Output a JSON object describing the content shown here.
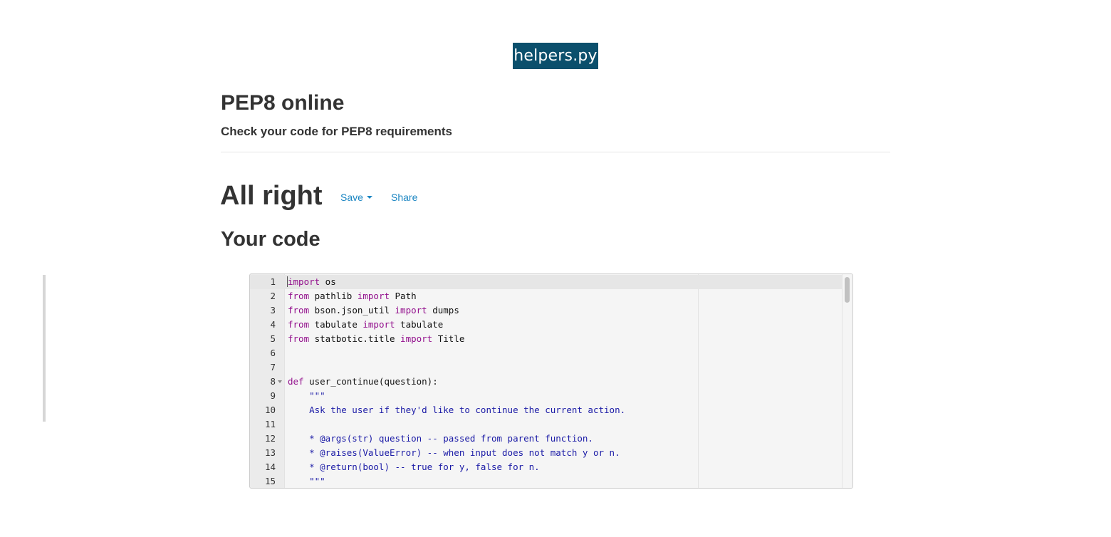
{
  "badge": {
    "filename": "helpers.py"
  },
  "header": {
    "title": "PEP8 online",
    "subtitle": "Check your code for PEP8 requirements"
  },
  "result": {
    "status": "All right",
    "save_label": "Save",
    "share_label": "Share"
  },
  "code_section": {
    "title": "Your code"
  },
  "colors": {
    "badge_bg": "#0b4f6c",
    "link": "#1a85c2",
    "keyword": "#93108d",
    "string": "#1a1aa6"
  },
  "editor": {
    "lines": [
      {
        "n": "1",
        "tokens": [
          {
            "t": "import",
            "c": "kw"
          },
          {
            "t": " os",
            "c": "id"
          }
        ]
      },
      {
        "n": "2",
        "tokens": [
          {
            "t": "from",
            "c": "kw"
          },
          {
            "t": " pathlib ",
            "c": "id"
          },
          {
            "t": "import",
            "c": "kw"
          },
          {
            "t": " Path",
            "c": "id"
          }
        ]
      },
      {
        "n": "3",
        "tokens": [
          {
            "t": "from",
            "c": "kw"
          },
          {
            "t": " bson.json_util ",
            "c": "id"
          },
          {
            "t": "import",
            "c": "kw"
          },
          {
            "t": " dumps",
            "c": "id"
          }
        ]
      },
      {
        "n": "4",
        "tokens": [
          {
            "t": "from",
            "c": "kw"
          },
          {
            "t": " tabulate ",
            "c": "id"
          },
          {
            "t": "import",
            "c": "kw"
          },
          {
            "t": " tabulate",
            "c": "id"
          }
        ]
      },
      {
        "n": "5",
        "tokens": [
          {
            "t": "from",
            "c": "kw"
          },
          {
            "t": " statbotic.title ",
            "c": "id"
          },
          {
            "t": "import",
            "c": "kw"
          },
          {
            "t": " Title",
            "c": "id"
          }
        ]
      },
      {
        "n": "6",
        "tokens": []
      },
      {
        "n": "7",
        "tokens": []
      },
      {
        "n": "8",
        "fold": true,
        "tokens": [
          {
            "t": "def",
            "c": "kw"
          },
          {
            "t": " user_continue(question):",
            "c": "id"
          }
        ]
      },
      {
        "n": "9",
        "tokens": [
          {
            "t": "    \"\"\"",
            "c": "str"
          }
        ]
      },
      {
        "n": "10",
        "tokens": [
          {
            "t": "    Ask the user if they'd like to continue the current action.",
            "c": "str"
          }
        ]
      },
      {
        "n": "11",
        "tokens": []
      },
      {
        "n": "12",
        "tokens": [
          {
            "t": "    * @args(str) question -- passed from parent function.",
            "c": "str"
          }
        ]
      },
      {
        "n": "13",
        "tokens": [
          {
            "t": "    * @raises(ValueError) -- when input does not match y or n.",
            "c": "str"
          }
        ]
      },
      {
        "n": "14",
        "tokens": [
          {
            "t": "    * @return(bool) -- true for y, false for n.",
            "c": "str"
          }
        ]
      },
      {
        "n": "15",
        "tokens": [
          {
            "t": "    \"\"\"",
            "c": "str"
          }
        ]
      }
    ]
  }
}
